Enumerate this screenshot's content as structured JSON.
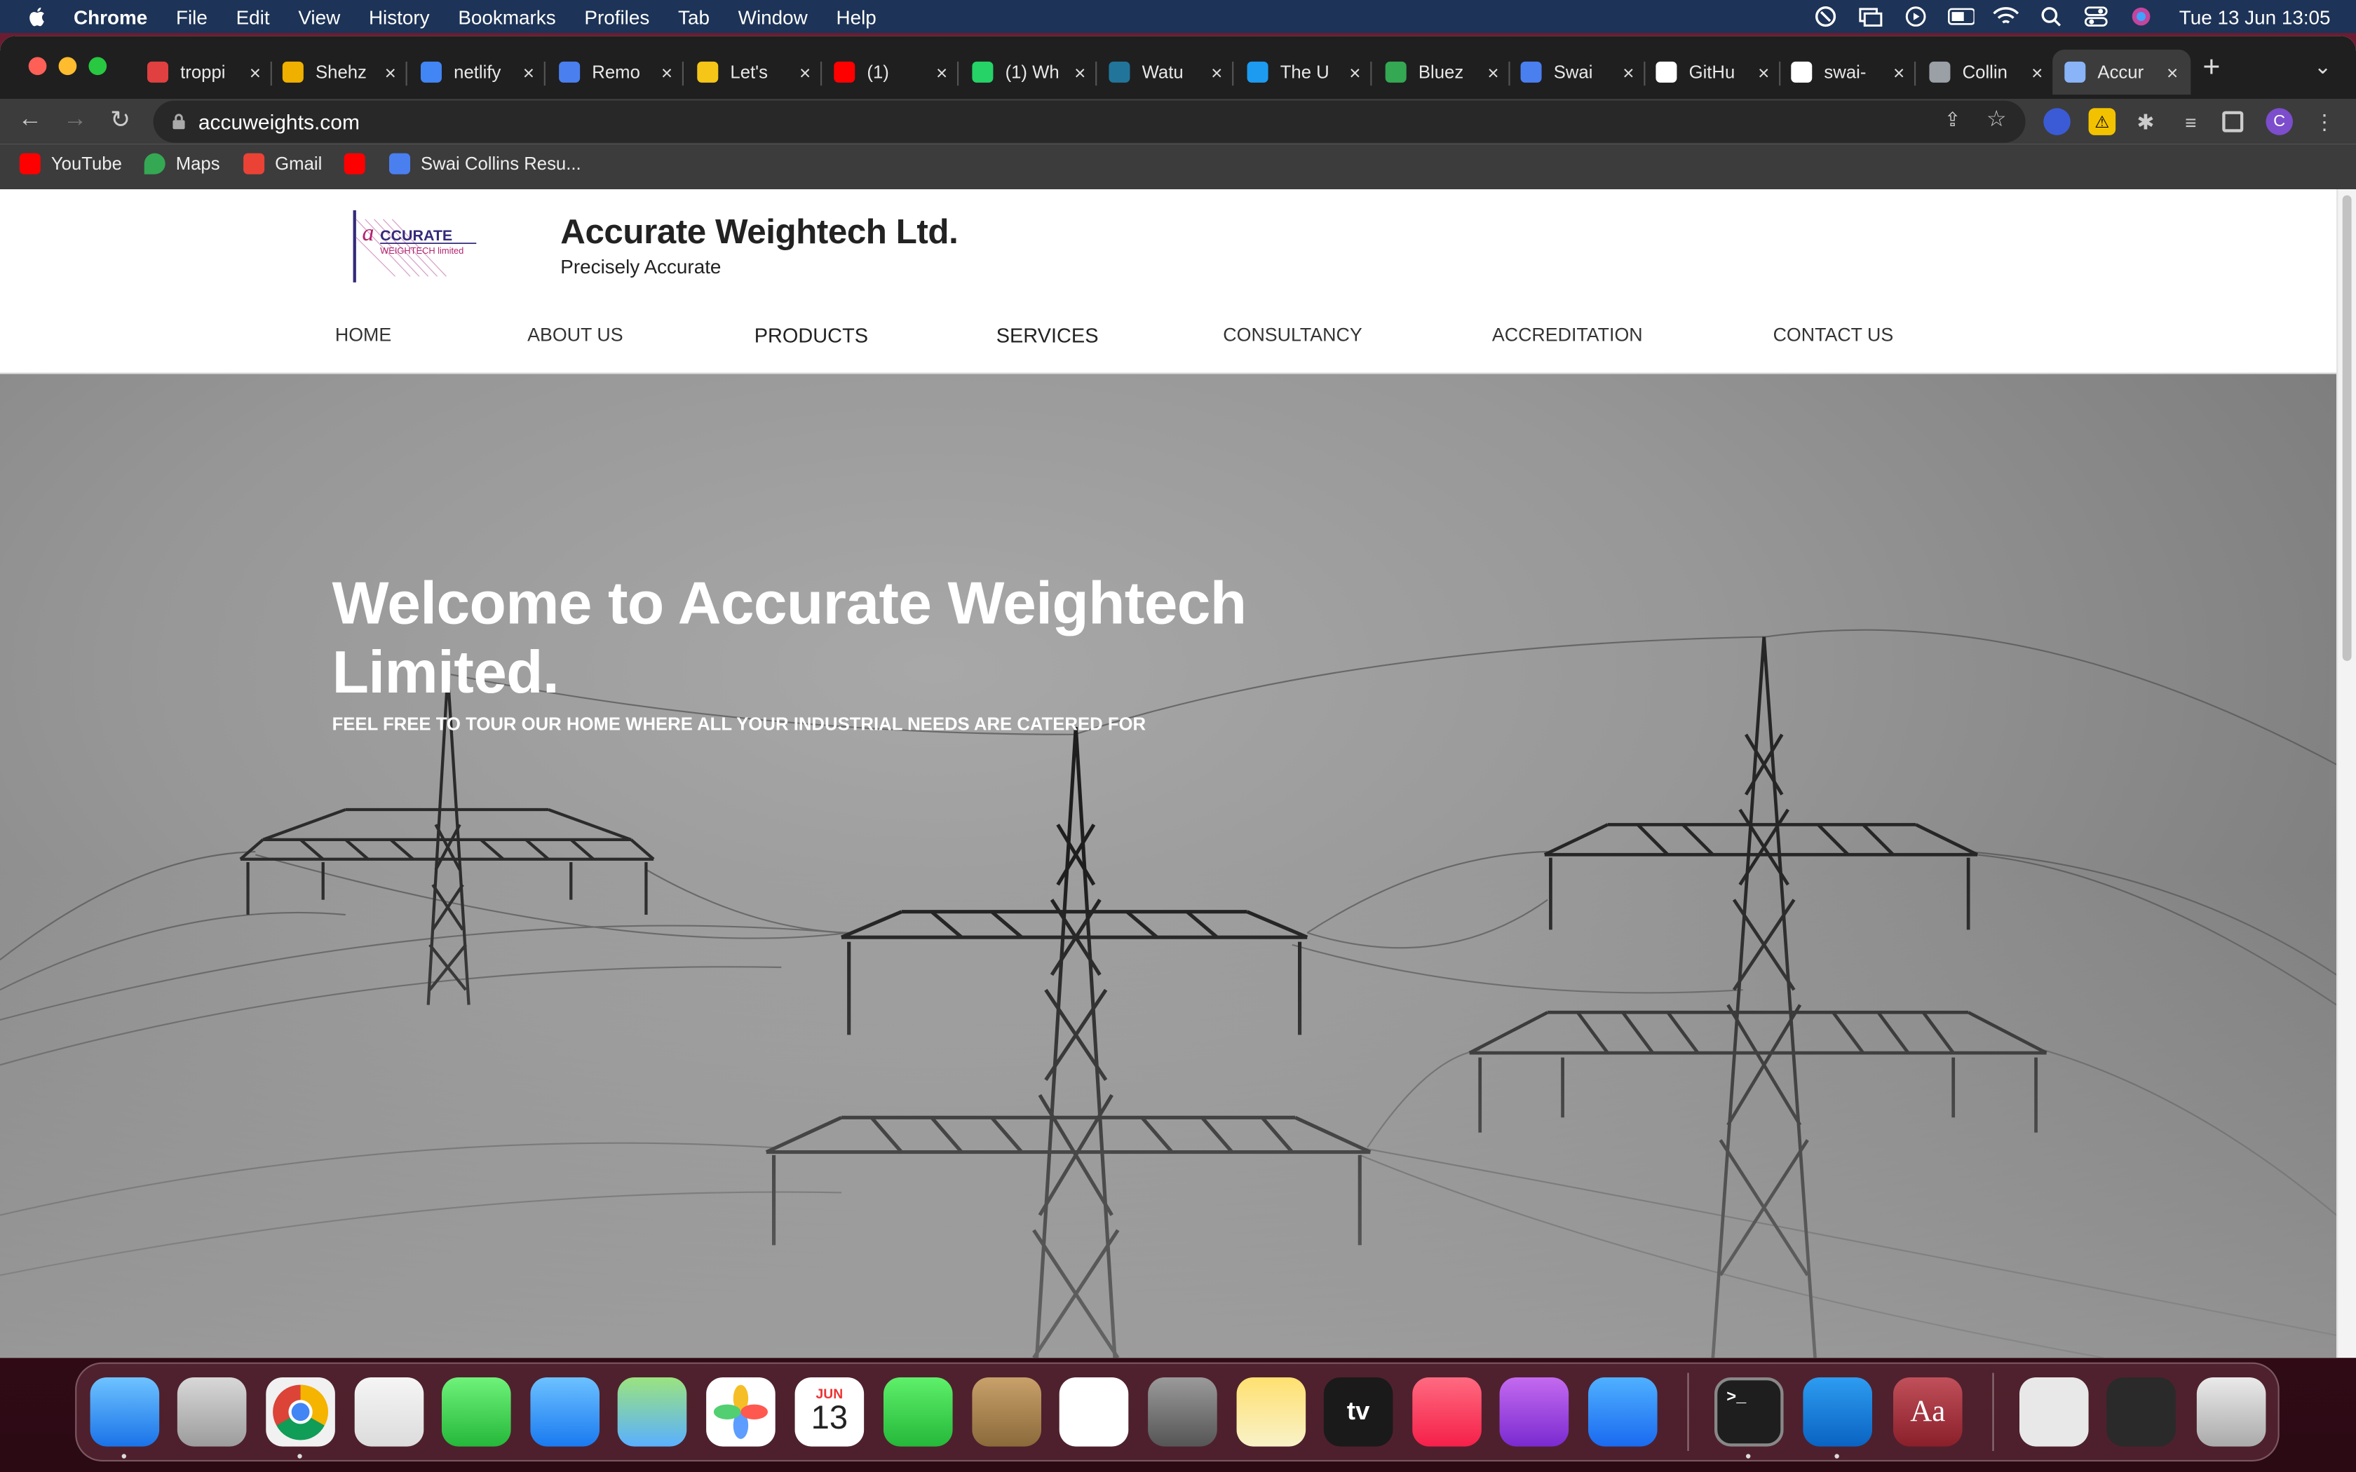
{
  "menubar": {
    "app_name": "Chrome",
    "menus": [
      "File",
      "Edit",
      "View",
      "History",
      "Bookmarks",
      "Profiles",
      "Tab",
      "Window",
      "Help"
    ],
    "clock": "Tue 13 Jun  13:05"
  },
  "tabs": [
    {
      "title": "troppi",
      "color": "#e04040"
    },
    {
      "title": "Shehz",
      "color": "#f0b000"
    },
    {
      "title": "netlify",
      "color": "#4285f4"
    },
    {
      "title": "Remo",
      "color": "#4a7ff0"
    },
    {
      "title": "Let's",
      "color": "#f5c518"
    },
    {
      "title": "(1)",
      "color": "#ff0000"
    },
    {
      "title": "(1) Wh",
      "color": "#25d366"
    },
    {
      "title": "Watu",
      "color": "#21759b"
    },
    {
      "title": "The U",
      "color": "#1d9bf0"
    },
    {
      "title": "Bluez",
      "color": "#34a853"
    },
    {
      "title": "Swai",
      "color": "#4a7ff0"
    },
    {
      "title": "GitHu",
      "color": "#ffffff"
    },
    {
      "title": "swai-",
      "color": "#ffffff"
    },
    {
      "title": "Collin",
      "color": "#9aa0a6"
    },
    {
      "title": "Accur",
      "color": "#8ab4f8"
    }
  ],
  "omnibox": {
    "url": "accuweights.com"
  },
  "profile_initial": "C",
  "bookmarks": [
    {
      "label": "YouTube",
      "color": "#ff0000"
    },
    {
      "label": "Maps",
      "color": "#34a853"
    },
    {
      "label": "Gmail",
      "color": "#ea4335"
    },
    {
      "label": "",
      "color": "#ff0000"
    },
    {
      "label": "Swai Collins Resu...",
      "color": "#4a7ff0"
    }
  ],
  "site": {
    "logo_text": "CCURATE",
    "logo_sub": "WEIGHTECH limited",
    "title": "Accurate Weightech Ltd.",
    "tagline": "Precisely Accurate",
    "nav": [
      "HOME",
      "ABOUT US",
      "PRODUCTS",
      "SERVICES",
      "CONSULTANCY",
      "ACCREDITATION",
      "CONTACT US"
    ],
    "hero_title": "Welcome to Accurate Weightech Limited.",
    "hero_subtitle": "FEEL FREE TO TOUR OUR HOME WHERE ALL YOUR INDUSTRIAL NEEDS ARE CATERED FOR"
  },
  "dock": {
    "apps": [
      "Finder",
      "Launchpad",
      "Chrome",
      "Safari",
      "Messages",
      "Mail",
      "Maps",
      "Photos",
      "Calendar",
      "FaceTime",
      "Contacts",
      "Reminders",
      "System Preferences",
      "Notes",
      "TV",
      "Music",
      "Podcasts",
      "App Store",
      "Terminal",
      "Visual Studio Code",
      "Dictionary",
      "Preview",
      "Screen",
      "Trash"
    ],
    "calendar_month": "JUN",
    "calendar_day": "13",
    "tv_label": "tv",
    "dictionary_label": "Aa"
  },
  "colors": {
    "menubar": "#1d3357",
    "tabstrip": "#1f1f1f",
    "toolbar": "#3c3c3c",
    "hero_text": "#ffffff"
  }
}
